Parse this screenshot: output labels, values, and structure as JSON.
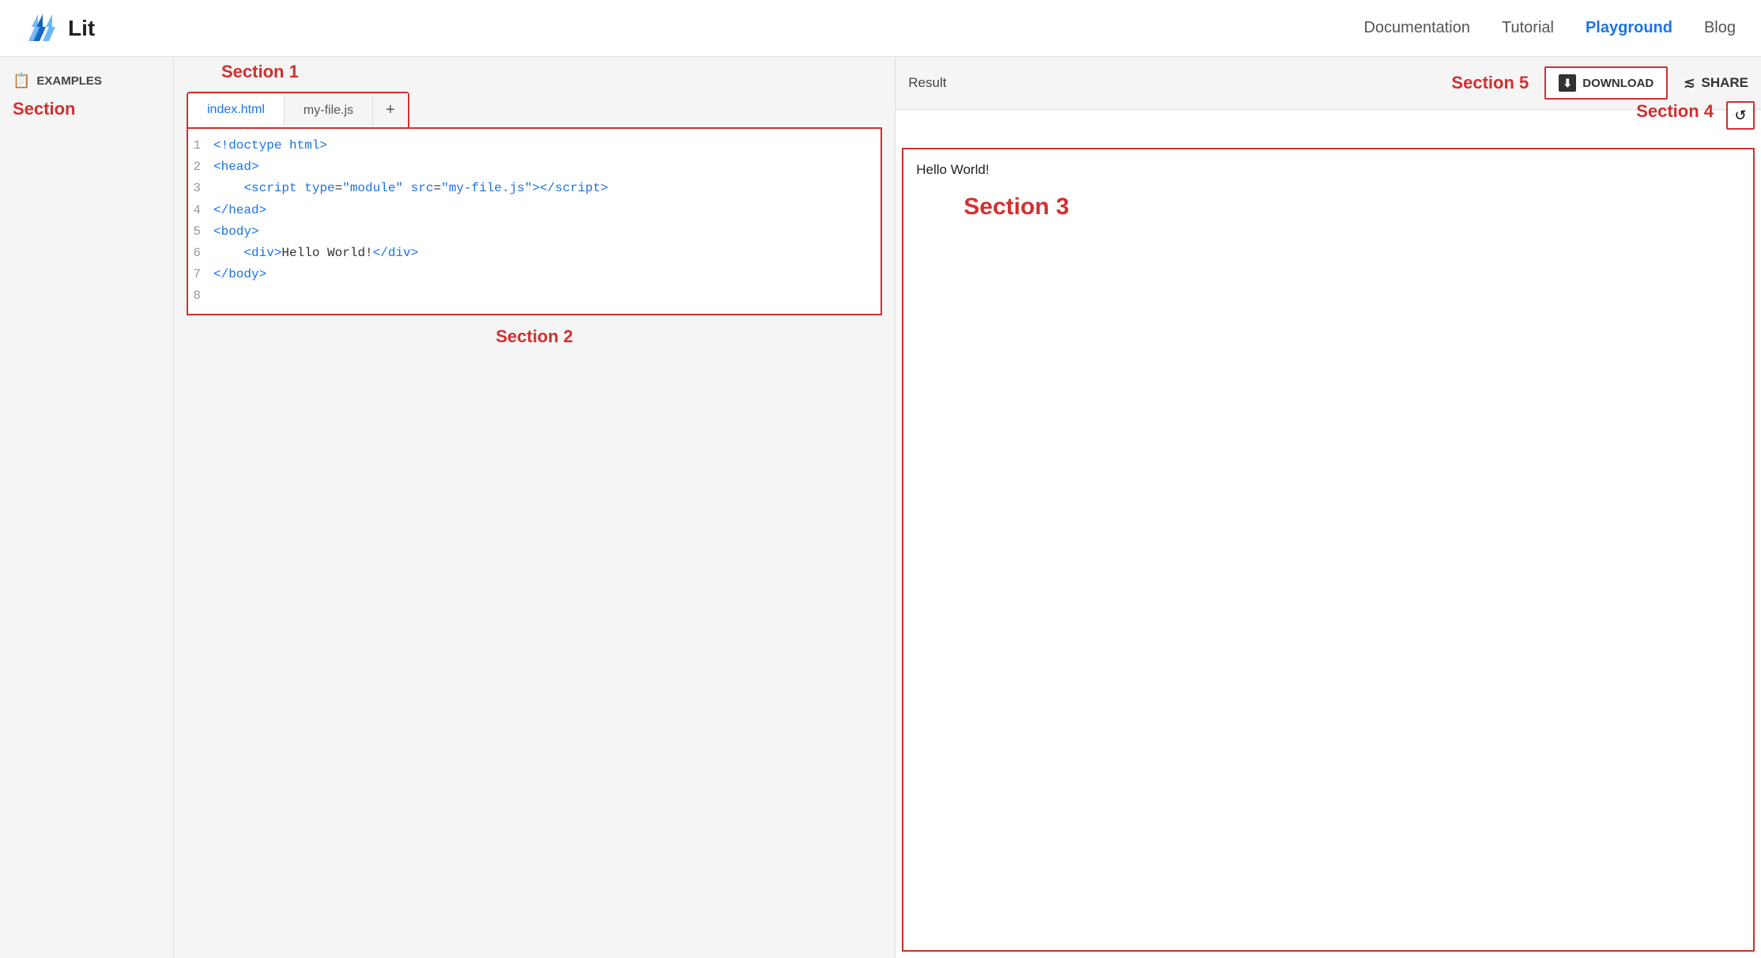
{
  "nav": {
    "logo_text": "Lit",
    "links": [
      {
        "label": "Documentation",
        "active": false
      },
      {
        "label": "Tutorial",
        "active": false
      },
      {
        "label": "Playground",
        "active": true
      },
      {
        "label": "Blog",
        "active": false
      }
    ]
  },
  "sidebar": {
    "title": "EXAMPLES",
    "section_label": "Section"
  },
  "editor": {
    "section1_label": "Section 1",
    "section2_label": "Section 2",
    "tabs": [
      {
        "label": "index.html",
        "active": true
      },
      {
        "label": "my-file.js",
        "active": false
      }
    ],
    "add_tab_label": "+",
    "code_lines": [
      {
        "num": "1",
        "content": "<!doctype html>"
      },
      {
        "num": "2",
        "content": "<head>"
      },
      {
        "num": "3",
        "content": "    <script type=\"module\" src=\"my-file.js\"></script>"
      },
      {
        "num": "4",
        "content": "</head>"
      },
      {
        "num": "5",
        "content": "<body>"
      },
      {
        "num": "6",
        "content": "    <div>Hello World!</div>"
      },
      {
        "num": "7",
        "content": "</body>"
      },
      {
        "num": "8",
        "content": ""
      }
    ]
  },
  "result_panel": {
    "result_label": "Result",
    "section5_label": "Section 5",
    "section4_label": "Section 4",
    "section3_label": "Section 3",
    "download_label": "DOWNLOAD",
    "share_label": "SHARE",
    "reload_icon": "↺",
    "hello_world": "Hello World!"
  }
}
